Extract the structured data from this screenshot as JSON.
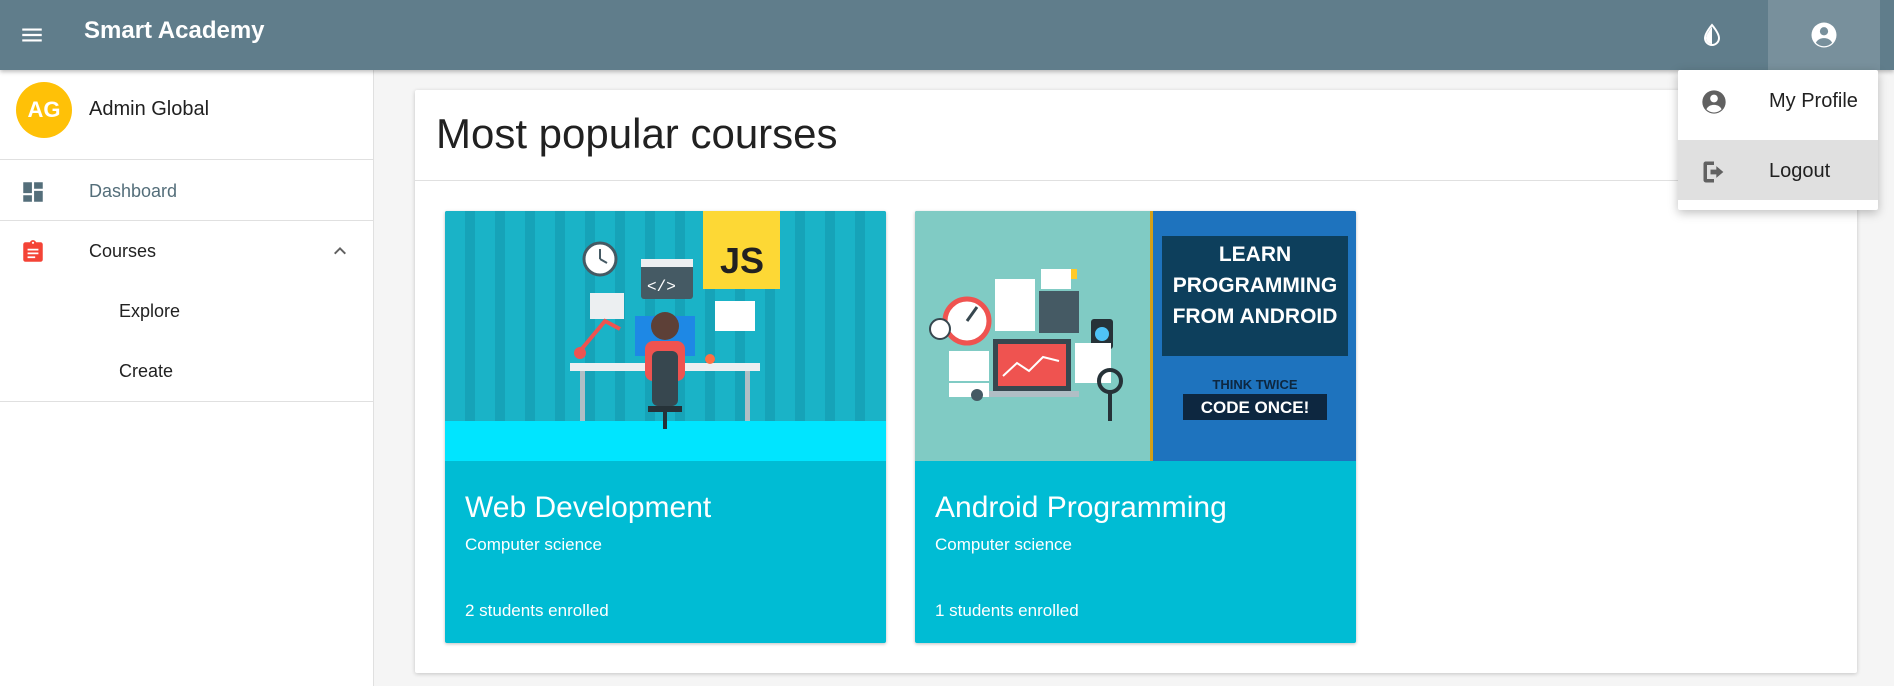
{
  "app": {
    "title": "Smart Academy"
  },
  "header": {
    "menu_icon": "menu-icon",
    "theme_icon": "invert-colors-icon",
    "account_icon": "account-circle-icon"
  },
  "account_menu": {
    "items": [
      {
        "label": "My Profile",
        "icon": "account-circle-icon"
      },
      {
        "label": "Logout",
        "icon": "logout-icon"
      }
    ]
  },
  "drawer": {
    "user": {
      "initials": "AG",
      "name": "Admin Global"
    },
    "items": [
      {
        "label": "Dashboard",
        "icon": "dashboard-icon"
      },
      {
        "label": "Courses",
        "icon": "assignment-icon",
        "expanded": true,
        "children": [
          {
            "label": "Explore"
          },
          {
            "label": "Create"
          }
        ]
      }
    ]
  },
  "main": {
    "title": "Most popular courses",
    "courses": [
      {
        "title": "Web Development",
        "category": "Computer science",
        "enrolled": "2 students enrolled",
        "image_text": "JS",
        "image_code": "</>"
      },
      {
        "title": "Android Programming",
        "category": "Computer science",
        "enrolled": "1 students enrolled",
        "image_text_lines": [
          "LEARN",
          "PROGRAMMING",
          "FROM ANDROID"
        ],
        "image_tagline": "THINK TWICE",
        "image_badge": "CODE ONCE!"
      }
    ]
  },
  "colors": {
    "appbar": "#607d8b",
    "account_btn": "#78909c",
    "avatar": "#ffc107",
    "card": "#00bcd4",
    "courses_icon": "#f44336",
    "dashboard_icon": "#546e7a"
  }
}
